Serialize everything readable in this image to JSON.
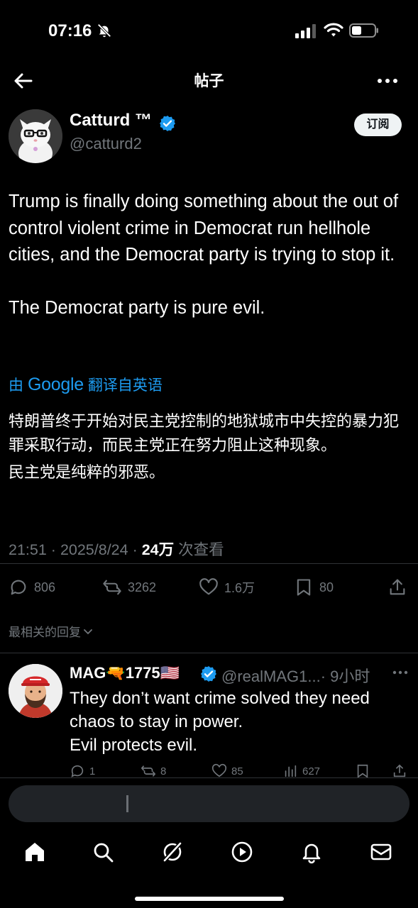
{
  "status_bar": {
    "time": "07:16"
  },
  "nav": {
    "title": "帖子"
  },
  "tweet": {
    "author_name": "Catturd ™",
    "author_handle": "@catturd2",
    "subscribe_label": "订阅",
    "paragraphs": [
      "Trump is finally doing something about the out of control violent crime in Democrat run hellhole cities, and the Democrat party is trying to stop it.",
      "The Democrat party is pure evil."
    ],
    "translate_prefix": "由",
    "translate_google": "Google",
    "translate_suffix": "翻译自英语",
    "translation": [
      "特朗普终于开始对民主党控制的地狱城市中失控的暴力犯罪采取行动，而民主党正在努力阻止这种现象。",
      "民主党是纯粹的邪恶。"
    ],
    "time": "21:51",
    "date": "2025/8/24",
    "views_count": "24万",
    "views_label": "次查看",
    "stats": {
      "replies": "806",
      "reposts": "3262",
      "likes": "1.6万",
      "bookmarks": "80"
    }
  },
  "replies_filter": {
    "label": "最相关的回复"
  },
  "reply": {
    "name": "MAG🔫1775🇺🇸",
    "handle": "@realMAG1...",
    "time": "· 9小时",
    "lines": [
      "They don’t want crime solved they need chaos to stay in power.",
      "Evil protects evil."
    ],
    "stats": {
      "replies": "1",
      "reposts": "8",
      "likes": "85",
      "views": "627"
    }
  },
  "colors": {
    "accent": "#1d9bf0",
    "background": "#000000",
    "secondary_text": "#71767b"
  }
}
